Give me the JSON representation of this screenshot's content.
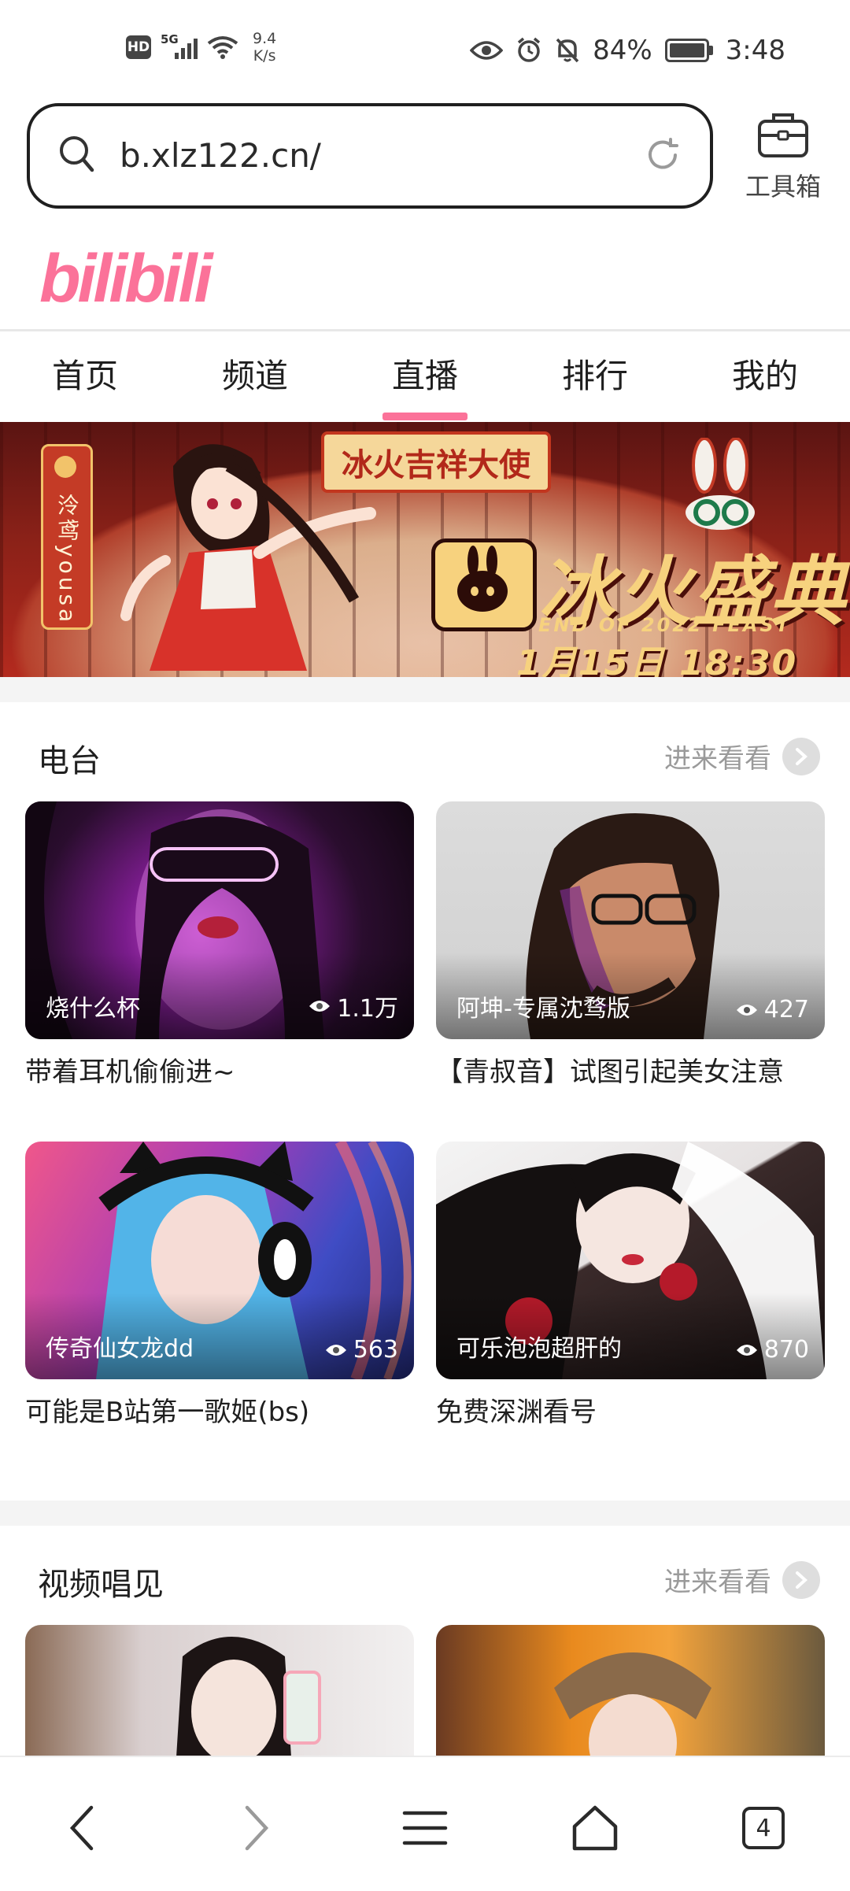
{
  "status_bar": {
    "hd": "HD",
    "signal_gen": "5G",
    "net_speed_value": "9.4",
    "net_speed_unit": "K/s",
    "battery": "84%",
    "time": "3:48"
  },
  "address_bar": {
    "url": "b.xlz122.cn/",
    "toolbox_label": "工具箱"
  },
  "site": {
    "logo_text": "bilibili",
    "brand_color": "#fb7299"
  },
  "nav": {
    "tabs": [
      "首页",
      "频道",
      "直播",
      "排行",
      "我的"
    ],
    "active_index": 2
  },
  "banner": {
    "side_tag": "泠鸢yousa",
    "subtitle": "冰火吉祥大使",
    "title": "冰火盛典",
    "english": "END OF 2022 FEAST",
    "date_time": "1月15日 18:30"
  },
  "radio_section": {
    "title": "电台",
    "more_label": "进来看看",
    "cards": [
      {
        "anchor": "烧什么杯",
        "views": "1.1万",
        "title": "带着耳机偷偷进~"
      },
      {
        "anchor": "阿坤-专属沈骛版",
        "views": "427",
        "title": "【青叔音】试图引起美女注意"
      },
      {
        "anchor": "传奇仙女龙dd",
        "views": "563",
        "title": "可能是B站第一歌姬(bs)"
      },
      {
        "anchor": "可乐泡泡超肝的",
        "views": "870",
        "title": "免费深渊看号"
      }
    ]
  },
  "video_section": {
    "title": "视频唱见",
    "more_label": "进来看看"
  },
  "bottom_nav": {
    "tab_count": "4"
  }
}
